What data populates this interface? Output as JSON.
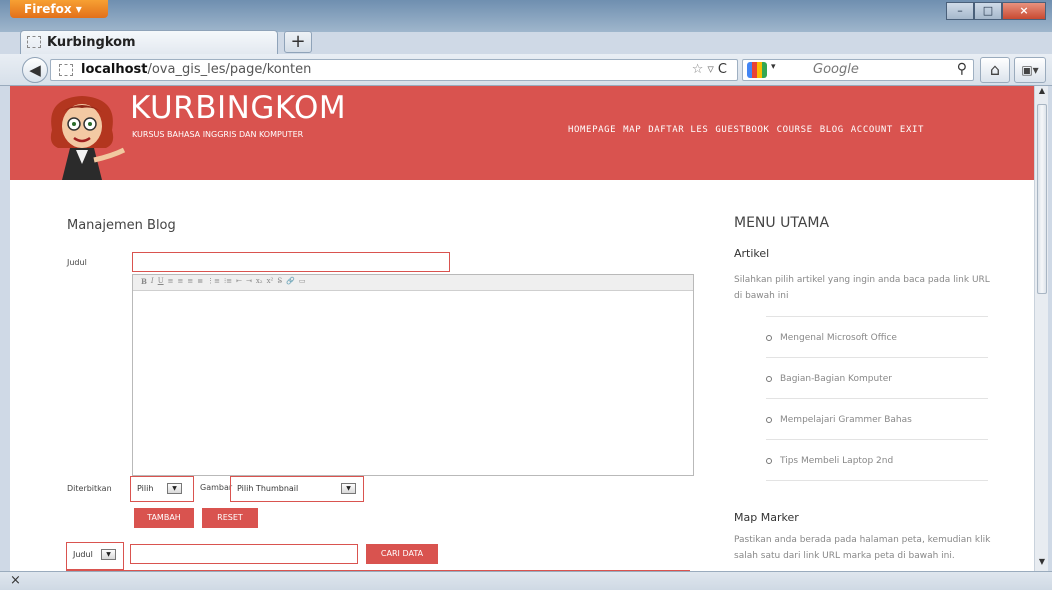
{
  "browser": {
    "app_button": "Firefox",
    "tab_title": "Kurbingkom",
    "new_tab": "+",
    "url_host": "localhost",
    "url_path": "/ova_gis_les/page/konten",
    "search_placeholder": "Google",
    "window_controls": [
      "–",
      "□",
      "×"
    ],
    "status_close": "×"
  },
  "site": {
    "title": "KURBINGKOM",
    "tagline": "KURSUS BAHASA INGGRIS DAN KOMPUTER",
    "nav": [
      "HOMEPAGE",
      "MAP",
      "DAFTAR LES",
      "GUESTBOOK",
      "COURSE",
      "BLOG",
      "ACCOUNT",
      "EXIT"
    ]
  },
  "blog_form": {
    "heading": "Manajemen Blog",
    "judul_label": "Judul",
    "judul_value": "",
    "diterbitkan_label": "Diterbitkan",
    "diterbitkan_selected": "Pilih",
    "gambar_label": "Gambar",
    "gambar_selected": "Pilih Thumbnail",
    "tambah_button": "TAMBAH",
    "reset_button": "RESET"
  },
  "search": {
    "field_selected": "Judul",
    "query": "",
    "button": "CARI DATA"
  },
  "sidebar": {
    "title": "MENU UTAMA",
    "artikel_title": "Artikel",
    "artikel_desc": "Silahkan pilih artikel yang ingin anda baca pada link URL di bawah ini",
    "artikel_items": [
      "Mengenal Microsoft Office",
      "Bagian-Bagian Komputer",
      "Mempelajari Grammer Bahas",
      "Tips Membeli Laptop 2nd"
    ],
    "map_title": "Map Marker",
    "map_desc": "Pastikan anda berada pada halaman peta, kemudian klik salah satu dari link URL marka peta di bawah ini."
  },
  "colors": {
    "header_red": "#d9534f",
    "button_red": "#d9534f"
  }
}
